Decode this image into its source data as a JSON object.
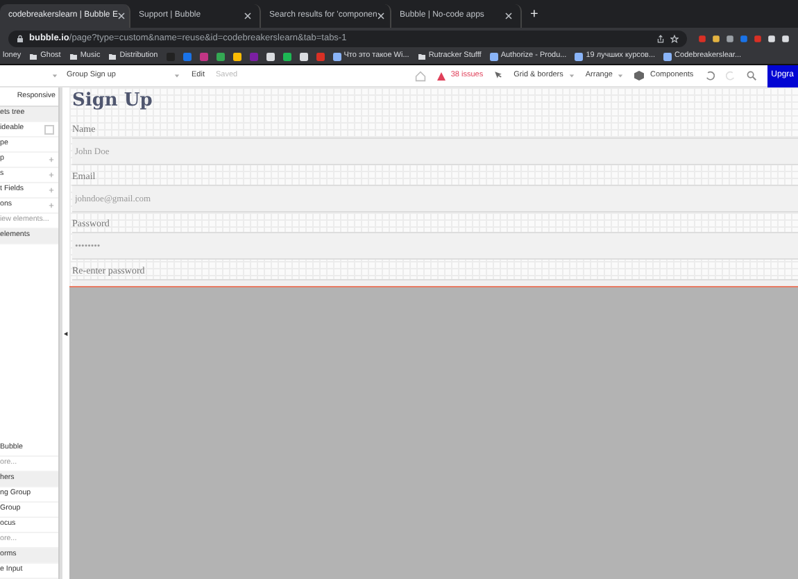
{
  "browser": {
    "tabs": [
      {
        "title": "codebreakerslearn | Bubble E",
        "selected": true
      },
      {
        "title": "Support | Bubble",
        "selected": false
      },
      {
        "title": "Search results for 'componen",
        "selected": false
      },
      {
        "title": "Bubble | No-code apps",
        "selected": false
      }
    ],
    "new_tab": "+",
    "address": {
      "host": "bubble.io",
      "path": "/page?type=custom&name=reuse&id=codebreakerslearn&tab=tabs-1"
    },
    "bookmarks_left": [
      {
        "label": "loney",
        "kind": "text"
      },
      {
        "label": "Ghost",
        "kind": "folder"
      },
      {
        "label": "Music",
        "kind": "folder"
      },
      {
        "label": "Distribution",
        "kind": "folder"
      }
    ],
    "bookmarks_right": [
      {
        "label": "Что это такое Wi...",
        "kind": "site"
      },
      {
        "label": "Rutracker Stufff",
        "kind": "folder"
      },
      {
        "label": "Authorize - Produ...",
        "kind": "site"
      },
      {
        "label": "19 лучших курсов...",
        "kind": "site"
      },
      {
        "label": "Codebreakerslear...",
        "kind": "site"
      }
    ]
  },
  "editor_toolbar": {
    "element": "Group Sign up",
    "mode": "Edit",
    "save_status": "Saved",
    "issues": "38 issues",
    "menus": [
      "Grid & borders",
      "Arrange"
    ],
    "components": "Components",
    "upgrade": "Upgra"
  },
  "left_panel": {
    "tabs": [
      {
        "label": "Responsive",
        "selected": false
      }
    ],
    "top_items": [
      {
        "kind": "header",
        "label": "ets tree"
      },
      {
        "kind": "checkbox",
        "label": "ideable",
        "checked": false
      },
      {
        "kind": "item",
        "label": "pe",
        "expandable": false
      },
      {
        "kind": "item",
        "label": "p",
        "expandable": true
      },
      {
        "kind": "item",
        "label": "s",
        "expandable": true
      },
      {
        "kind": "item",
        "label": "t Fields",
        "expandable": true
      },
      {
        "kind": "item",
        "label": "ons",
        "expandable": true
      },
      {
        "kind": "link",
        "label": "iew elements..."
      },
      {
        "kind": "header",
        "label": "elements"
      }
    ],
    "bottom_items": [
      {
        "kind": "item",
        "label": "Bubble",
        "expandable": false
      },
      {
        "kind": "link",
        "label": "ore..."
      },
      {
        "kind": "header",
        "label": "hers"
      },
      {
        "kind": "item",
        "label": "ng Group",
        "expandable": false
      },
      {
        "kind": "item",
        "label": "Group",
        "expandable": false
      },
      {
        "kind": "item",
        "label": "ocus",
        "expandable": false
      },
      {
        "kind": "link",
        "label": "ore..."
      },
      {
        "kind": "header",
        "label": "orms"
      },
      {
        "kind": "item",
        "label": "e Input",
        "expandable": false
      }
    ]
  },
  "canvas": {
    "title": "Sign Up",
    "fields": [
      {
        "label": "Name",
        "placeholder": "John Doe"
      },
      {
        "label": "Email",
        "placeholder": "johndoe@gmail.com"
      },
      {
        "label": "Password",
        "placeholder": "••••••••"
      },
      {
        "label": "Re-enter password"
      }
    ]
  }
}
